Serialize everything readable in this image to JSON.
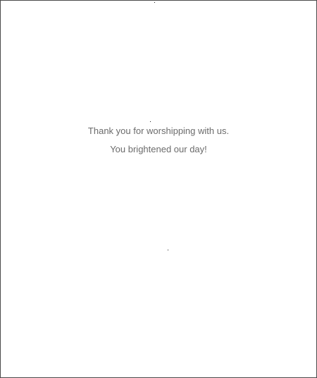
{
  "message": {
    "line_1": "Thank you for worshipping with us.",
    "line_2": "You brightened our day!"
  }
}
